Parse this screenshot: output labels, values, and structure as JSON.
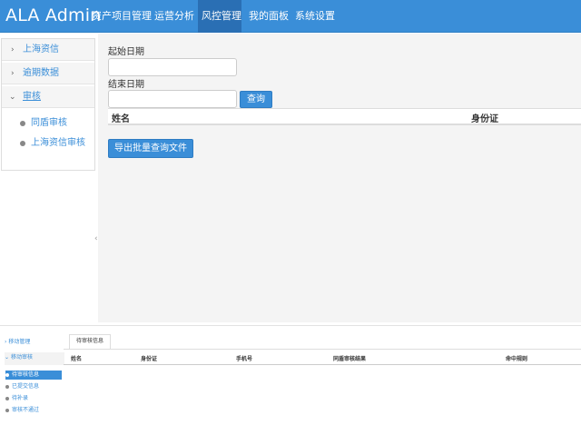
{
  "app": {
    "brand": "ALA Admin"
  },
  "topnav": {
    "items": [
      "资产项目管理",
      "运营分析",
      "风控管理",
      "我的面板",
      "系统设置"
    ],
    "active_index": 2
  },
  "sidebar": {
    "items": [
      {
        "label": "上海资信",
        "chevron": "›"
      },
      {
        "label": "逾期数据",
        "chevron": "›"
      },
      {
        "label": "审核",
        "chevron": "⌄"
      }
    ],
    "subitems": [
      "同盾审核",
      "上海资信审核"
    ]
  },
  "form": {
    "start_label": "起始日期",
    "start_value": "",
    "end_label": "结束日期",
    "end_value": "",
    "query_button": "查询"
  },
  "table": {
    "columns": [
      "姓名",
      "身份证"
    ]
  },
  "export_button": "导出批量查询文件",
  "bottom": {
    "sidebar": [
      {
        "label": "移动管理",
        "chevron": "›"
      },
      {
        "label": "移动审核",
        "chevron": "⌄"
      }
    ],
    "subitems": [
      "待审核信息",
      "已提交信息",
      "待补录",
      "审核不通过"
    ],
    "active_sub_index": 0,
    "tab": "待审核信息",
    "columns": [
      "姓名",
      "身份证",
      "手机号",
      "同盾审核结果",
      "命中规则"
    ]
  }
}
